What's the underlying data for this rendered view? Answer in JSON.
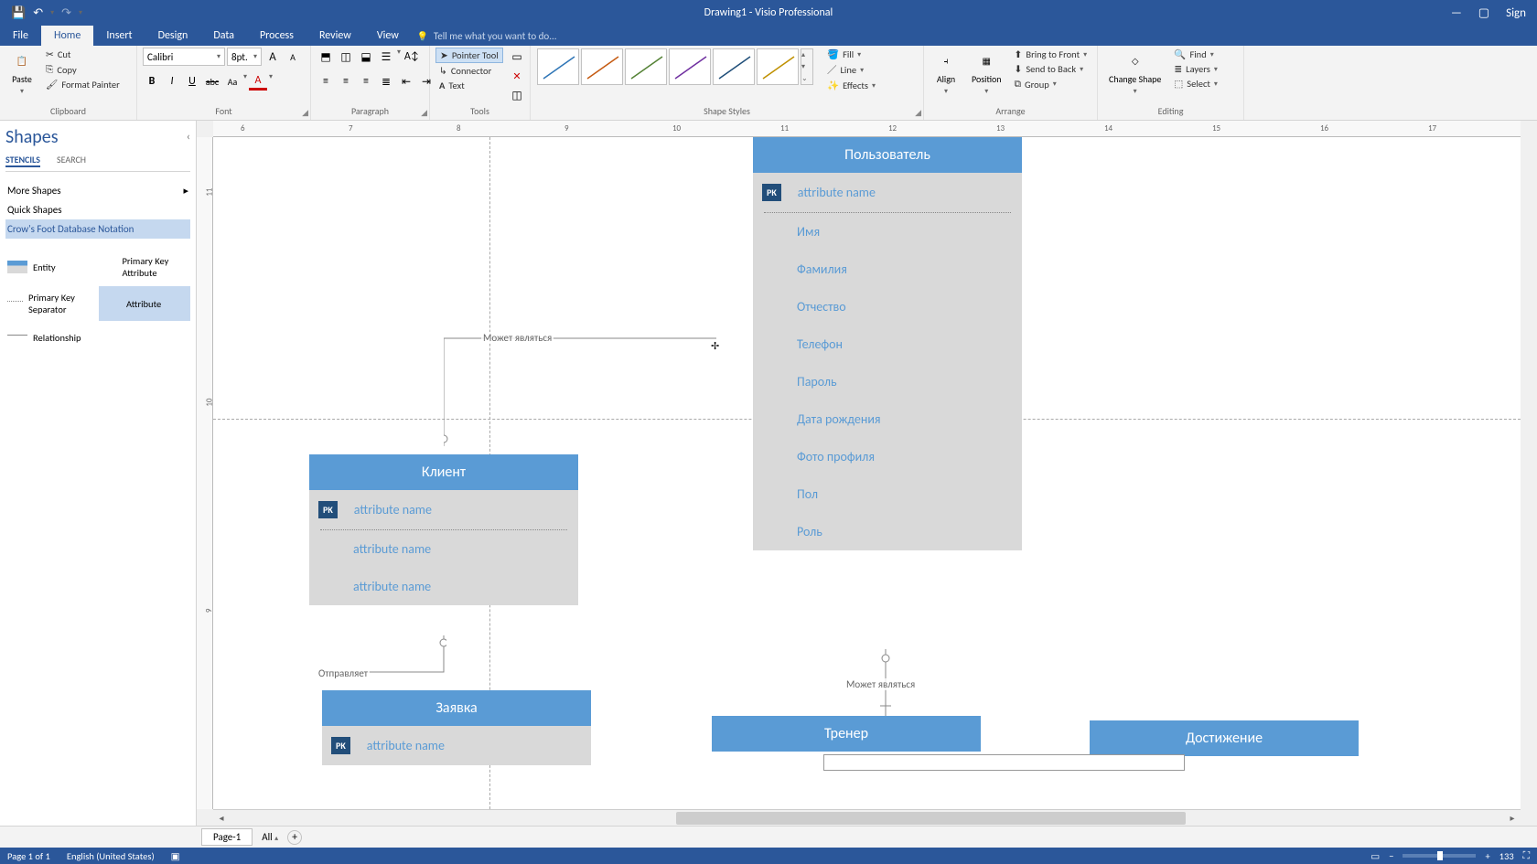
{
  "app": {
    "title": "Drawing1 - Visio Professional",
    "sign_in": "Sign"
  },
  "qat": {
    "save": "💾",
    "undo": "↶",
    "redo": "↷",
    "custom": "▾"
  },
  "win": {
    "min": "—",
    "max": "▢",
    "close": "✕"
  },
  "tabs": {
    "file": "File",
    "home": "Home",
    "insert": "Insert",
    "design": "Design",
    "data": "Data",
    "process": "Process",
    "review": "Review",
    "view": "View",
    "tellme": "Tell me what you want to do..."
  },
  "ribbon": {
    "clipboard": {
      "label": "Clipboard",
      "paste": "Paste",
      "cut": "Cut",
      "copy": "Copy",
      "format_painter": "Format Painter"
    },
    "font": {
      "label": "Font",
      "name": "Calibri",
      "size": "8pt.",
      "bold": "B",
      "italic": "I",
      "underline": "U",
      "strike": "abc",
      "caseAa": "Aa",
      "grow": "A",
      "shrink": "A"
    },
    "paragraph": {
      "label": "Paragraph"
    },
    "tools": {
      "label": "Tools",
      "pointer": "Pointer Tool",
      "connector": "Connector",
      "text": "Text",
      "x": "✕"
    },
    "shapestyles": {
      "label": "Shape Styles",
      "fill": "Fill",
      "line": "Line",
      "effects": "Effects"
    },
    "arrange": {
      "label": "Arrange",
      "align": "Align",
      "position": "Position",
      "bring": "Bring to Front",
      "send": "Send to Back",
      "group": "Group"
    },
    "editing": {
      "label": "Editing",
      "change": "Change Shape",
      "find": "Find",
      "layers": "Layers",
      "select": "Select"
    }
  },
  "shapes": {
    "title": "Shapes",
    "stencils_tab": "STENCILS",
    "search_tab": "SEARCH",
    "more": "More Shapes",
    "quick": "Quick Shapes",
    "active_stencil": "Crow's Foot Database Notation",
    "items": {
      "entity": "Entity",
      "pk_attr": "Primary Key Attribute",
      "pk_sep": "Primary Key Separator",
      "attribute": "Attribute",
      "relationship": "Relationship"
    }
  },
  "canvas": {
    "ruler_h": [
      "6",
      "7",
      "8",
      "9",
      "10",
      "11",
      "12",
      "13",
      "14",
      "15",
      "16",
      "17"
    ],
    "ruler_v": [
      "11",
      "10",
      "9"
    ],
    "entities": {
      "user": {
        "title": "Пользователь",
        "pk": "PK",
        "pk_attr": "attribute name",
        "attrs": [
          "Имя",
          "Фамилия",
          "Отчество",
          "Телефон",
          "Пароль",
          "Дата рождения",
          "Фото профиля",
          "Пол",
          "Роль"
        ]
      },
      "client": {
        "title": "Клиент",
        "pk": "PK",
        "pk_attr": "attribute name",
        "attrs": [
          "attribute name",
          "attribute name"
        ]
      },
      "request": {
        "title": "Заявка",
        "pk": "PK",
        "pk_attr": "attribute name"
      },
      "trainer": {
        "title": "Тренер"
      },
      "achievement": {
        "title": "Достижение"
      }
    },
    "rel": {
      "can_be_1": "Может являться",
      "can_be_2": "Может являться",
      "sends": "Отправляет"
    }
  },
  "pages": {
    "page1": "Page-1",
    "all": "All"
  },
  "status": {
    "page": "Page 1 of 1",
    "lang": "English (United States)",
    "zoom": "133"
  }
}
